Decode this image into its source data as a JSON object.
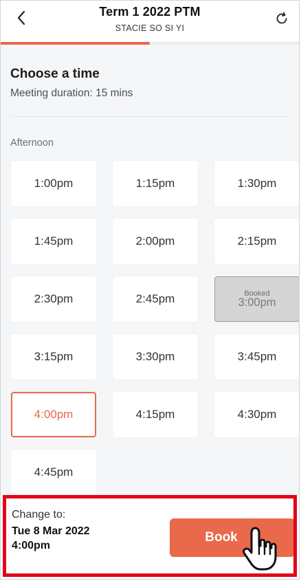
{
  "header": {
    "title": "Term 1 2022 PTM",
    "subtitle": "STACIE SO SI YI",
    "back_icon": "chevron-left-icon",
    "refresh_icon": "refresh-icon"
  },
  "progress": {
    "fraction": 0.5
  },
  "choose": {
    "title": "Choose a time",
    "duration": "Meeting duration: 15 mins"
  },
  "section": {
    "label": "Afternoon"
  },
  "slots": [
    {
      "time": "1:00pm",
      "state": "available"
    },
    {
      "time": "1:15pm",
      "state": "available"
    },
    {
      "time": "1:30pm",
      "state": "available"
    },
    {
      "time": "1:45pm",
      "state": "available"
    },
    {
      "time": "2:00pm",
      "state": "available"
    },
    {
      "time": "2:15pm",
      "state": "available"
    },
    {
      "time": "2:30pm",
      "state": "available"
    },
    {
      "time": "2:45pm",
      "state": "available"
    },
    {
      "time": "3:00pm",
      "state": "booked",
      "booked_label": "Booked"
    },
    {
      "time": "3:15pm",
      "state": "available"
    },
    {
      "time": "3:30pm",
      "state": "available"
    },
    {
      "time": "3:45pm",
      "state": "available"
    },
    {
      "time": "4:00pm",
      "state": "selected"
    },
    {
      "time": "4:15pm",
      "state": "available"
    },
    {
      "time": "4:30pm",
      "state": "available"
    },
    {
      "time": "4:45pm",
      "state": "available"
    }
  ],
  "footer": {
    "change_label": "Change to:",
    "date": "Tue 8 Mar 2022",
    "time": "4:00pm",
    "book_label": "Book",
    "cursor_icon": "pointing-hand-icon"
  },
  "colors": {
    "accent": "#e86a4a",
    "highlight": "#e3001b",
    "booked": "#d5d5d5"
  }
}
